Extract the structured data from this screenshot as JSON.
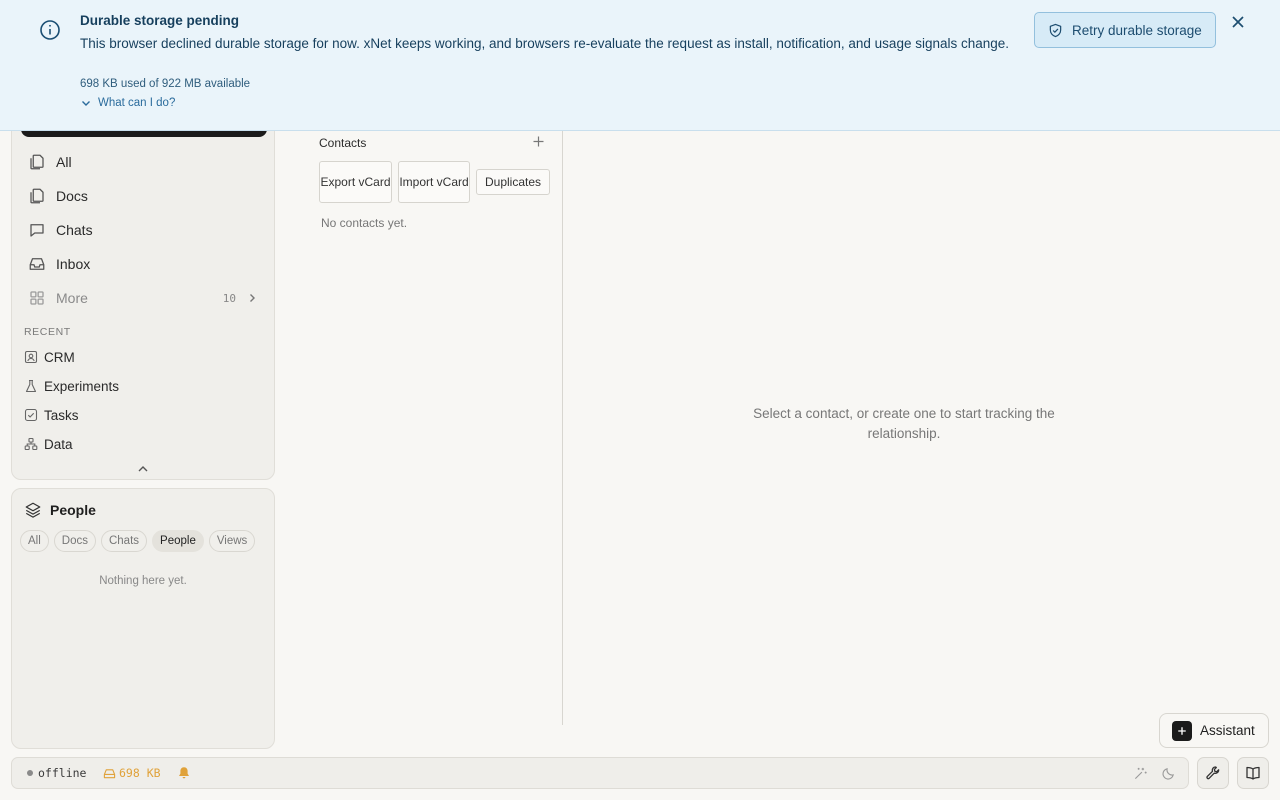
{
  "banner": {
    "title": "Durable storage pending",
    "message": "This browser declined durable storage for now. xNet keeps working, and browsers re-evaluate the request as install, notification, and usage signals change.",
    "usage": "698 KB used of 922 MB available",
    "help_link": "What can I do?",
    "retry_label": "Retry durable storage"
  },
  "nav": {
    "items": [
      {
        "label": "All",
        "icon": "docs-icon"
      },
      {
        "label": "Docs",
        "icon": "docs-icon"
      },
      {
        "label": "Chats",
        "icon": "chat-icon"
      },
      {
        "label": "Inbox",
        "icon": "inbox-icon"
      },
      {
        "label": "More",
        "icon": "grid-icon",
        "count": "10"
      }
    ],
    "recent_label": "RECENT",
    "recent": [
      {
        "label": "CRM",
        "icon": "contact-card-icon"
      },
      {
        "label": "Experiments",
        "icon": "flask-icon"
      },
      {
        "label": "Tasks",
        "icon": "checkbox-icon"
      },
      {
        "label": "Data",
        "icon": "graph-icon"
      }
    ]
  },
  "people": {
    "title": "People",
    "filters": [
      "All",
      "Docs",
      "Chats",
      "People",
      "Views"
    ],
    "active_filter": "People",
    "empty": "Nothing here yet."
  },
  "contacts": {
    "title": "Contacts",
    "export_label": "Export vCard",
    "import_label": "Import vCard",
    "duplicates_label": "Duplicates",
    "empty": "No contacts yet."
  },
  "main": {
    "empty_state": "Select a contact, or create one to start tracking the relationship."
  },
  "assistant": {
    "label": "Assistant"
  },
  "status": {
    "connection": "offline",
    "storage": "698 KB",
    "accent_color": "#e0a23a"
  }
}
